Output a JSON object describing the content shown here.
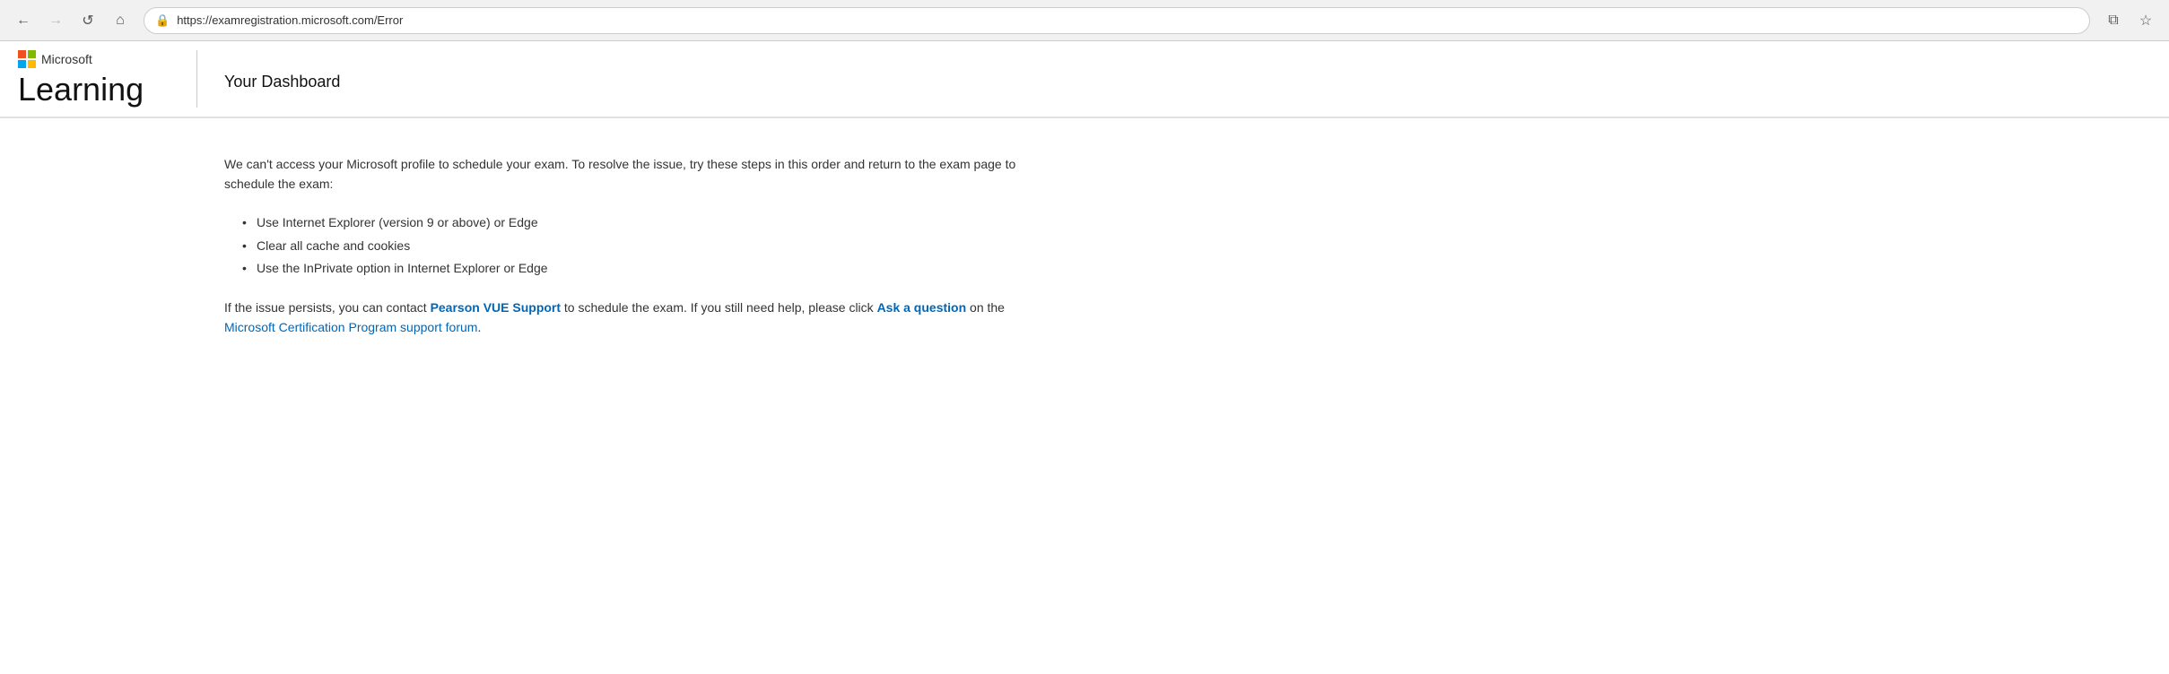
{
  "browser": {
    "url": "https://examregistration.microsoft.com/Error",
    "back_btn": "←",
    "forward_btn": "→",
    "refresh_btn": "↺",
    "home_btn": "⌂",
    "tab_btn": "⧉",
    "star_btn": "☆"
  },
  "header": {
    "microsoft_label": "Microsoft",
    "learning_label": "Learning",
    "dashboard_title": "Your Dashboard"
  },
  "content": {
    "intro_text": "We can't access your Microsoft profile to schedule your exam. To resolve the issue, try these steps in this order and return to the exam page to schedule the exam:",
    "list_items": [
      "Use Internet Explorer (version 9 or above) or Edge",
      "Clear all cache and cookies",
      "Use the InPrivate option in Internet Explorer or Edge"
    ],
    "support_text_before": "If the issue persists, you can contact ",
    "support_link_label": "Pearson VUE Support",
    "support_text_middle": " to schedule the exam. If you still need help, please click ",
    "ask_question_label": "Ask a question",
    "support_text_after": " on the",
    "forum_link_label": "Microsoft Certification Program support forum",
    "forum_text_after": "."
  }
}
